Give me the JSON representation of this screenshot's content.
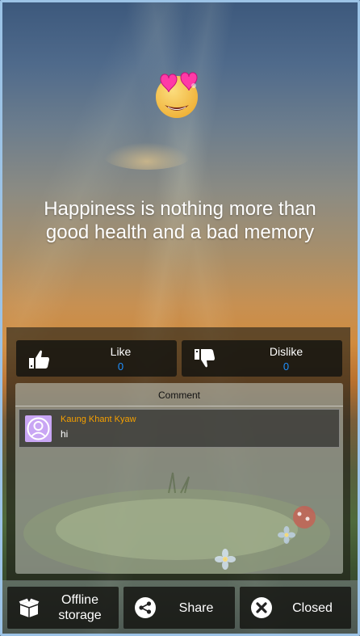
{
  "quote": {
    "text_line1": "Happiness is nothing more than",
    "text_line2": "good health and a bad memory",
    "emoji_icon": "heart-eyes-emoji-icon"
  },
  "reactions": {
    "like": {
      "label": "Like",
      "count": "0",
      "icon": "thumbs-up-icon"
    },
    "dislike": {
      "label": "Dislike",
      "count": "0",
      "icon": "thumbs-down-icon"
    }
  },
  "comments": {
    "title": "Comment",
    "items": [
      {
        "author": "Kaung Khant Kyaw",
        "text": "hi",
        "avatar_icon": "user-avatar-icon"
      }
    ]
  },
  "bottom_bar": {
    "offline_label_line1": "Offline",
    "offline_label_line2": "storage",
    "share_label": "Share",
    "closed_label": "Closed"
  },
  "colors": {
    "count_blue": "#1e90ff",
    "author_orange": "#f5a000",
    "avatar_purple": "#c9a6f4"
  }
}
